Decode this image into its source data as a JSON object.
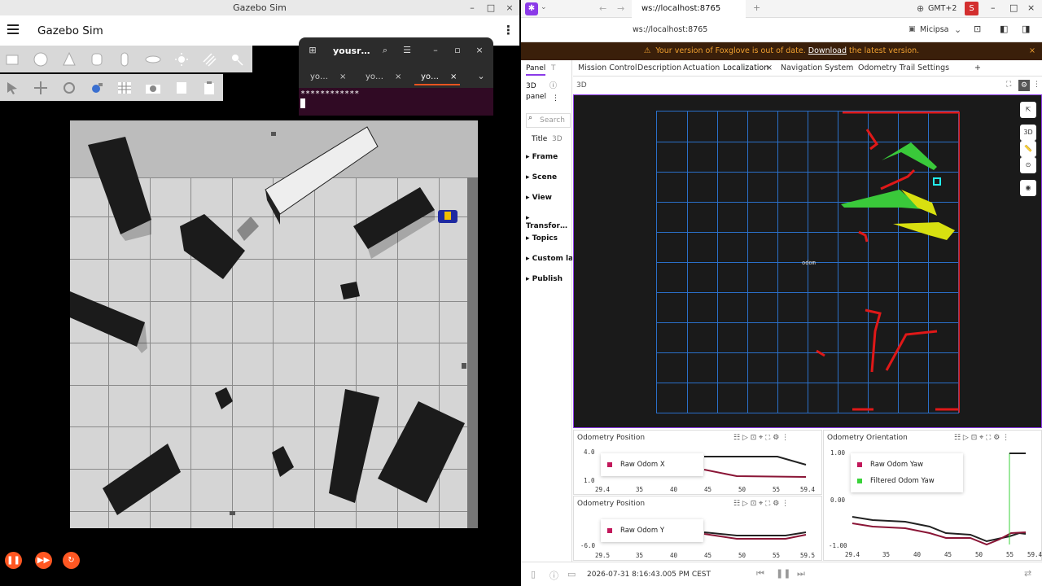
{
  "gazebo": {
    "window_title": "Gazebo Sim",
    "header_title": "Gazebo Sim",
    "minimize": "–",
    "maximize": "□",
    "close": "×",
    "menu_icon": "hamburger-menu-icon",
    "kebab": "⋮",
    "toolbar_row1": [
      "box-icon",
      "sphere-icon",
      "cone-icon",
      "cylinder-icon",
      "capsule-icon",
      "ellipsoid-icon",
      "sun-icon",
      "directional-light-icon",
      "spot-light-icon"
    ],
    "toolbar_row2": [
      "select-icon",
      "translate-icon",
      "rotate-icon",
      "snap-icon",
      "grid-icon",
      "camera-icon",
      "copy-icon",
      "paste-icon"
    ],
    "controls": [
      "pause-icon",
      "step-icon",
      "reset-icon"
    ]
  },
  "terminal": {
    "title": "yousr…",
    "tabs": [
      "yo…",
      "yo…",
      "yo…"
    ],
    "content": "************"
  },
  "foxglove": {
    "url": "ws://localhost:8765",
    "address": "ws://localhost:8765",
    "timezone": "GMT+2",
    "user_initial": "S",
    "workspace": "Micipsa",
    "warning_pre": "Your version of Foxglove is out of date.",
    "warning_link": "Download",
    "warning_post": "the latest version.",
    "left_panel": {
      "tab_panel": "Panel",
      "tab_topics": "T",
      "name_line1": "3D",
      "name_line2": "panel",
      "search_placeholder": "Search",
      "title_label": "Title",
      "title_value": "3D",
      "sections": [
        "Frame",
        "Scene",
        "View",
        "Transfor…",
        "Topics",
        "Custom laye",
        "Publish"
      ]
    },
    "layout_tabs": [
      "Mission Control",
      "Description",
      "Actuation",
      "Localization",
      "Navigation",
      "System",
      "Odometry Trail Settings"
    ],
    "active_tab": "Localization",
    "panel_3d_title": "3D",
    "frame_label": "odom",
    "tools": [
      "3D",
      "ruler",
      "⊙"
    ],
    "plots": [
      {
        "title": "Odometry Position",
        "legend": [
          {
            "name": "Raw Odom X",
            "color": "#c2185b"
          }
        ],
        "yticks": [
          "4.0",
          "1.0"
        ],
        "xticks": [
          "29.4",
          "35",
          "40",
          "45",
          "50",
          "55",
          "59.4"
        ]
      },
      {
        "title": "Odometry Position",
        "legend": [
          {
            "name": "Raw Odom Y",
            "color": "#c2185b"
          }
        ],
        "yticks": [
          "-6.0"
        ],
        "xticks": [
          "29.5",
          "35",
          "40",
          "45",
          "50",
          "55",
          "59.5"
        ]
      },
      {
        "title": "Odometry Orientation",
        "legend": [
          {
            "name": "Raw Odom Yaw",
            "color": "#c2185b"
          },
          {
            "name": "Filtered Odom Yaw",
            "color": "#3ad33a"
          }
        ],
        "yticks": [
          "1.00",
          "0.00",
          "-1.00"
        ],
        "xticks": [
          "29.4",
          "35",
          "40",
          "45",
          "50",
          "55",
          "59.4"
        ]
      }
    ],
    "timestamp": "2026-07-31 8:16:43.005 PM CEST"
  }
}
